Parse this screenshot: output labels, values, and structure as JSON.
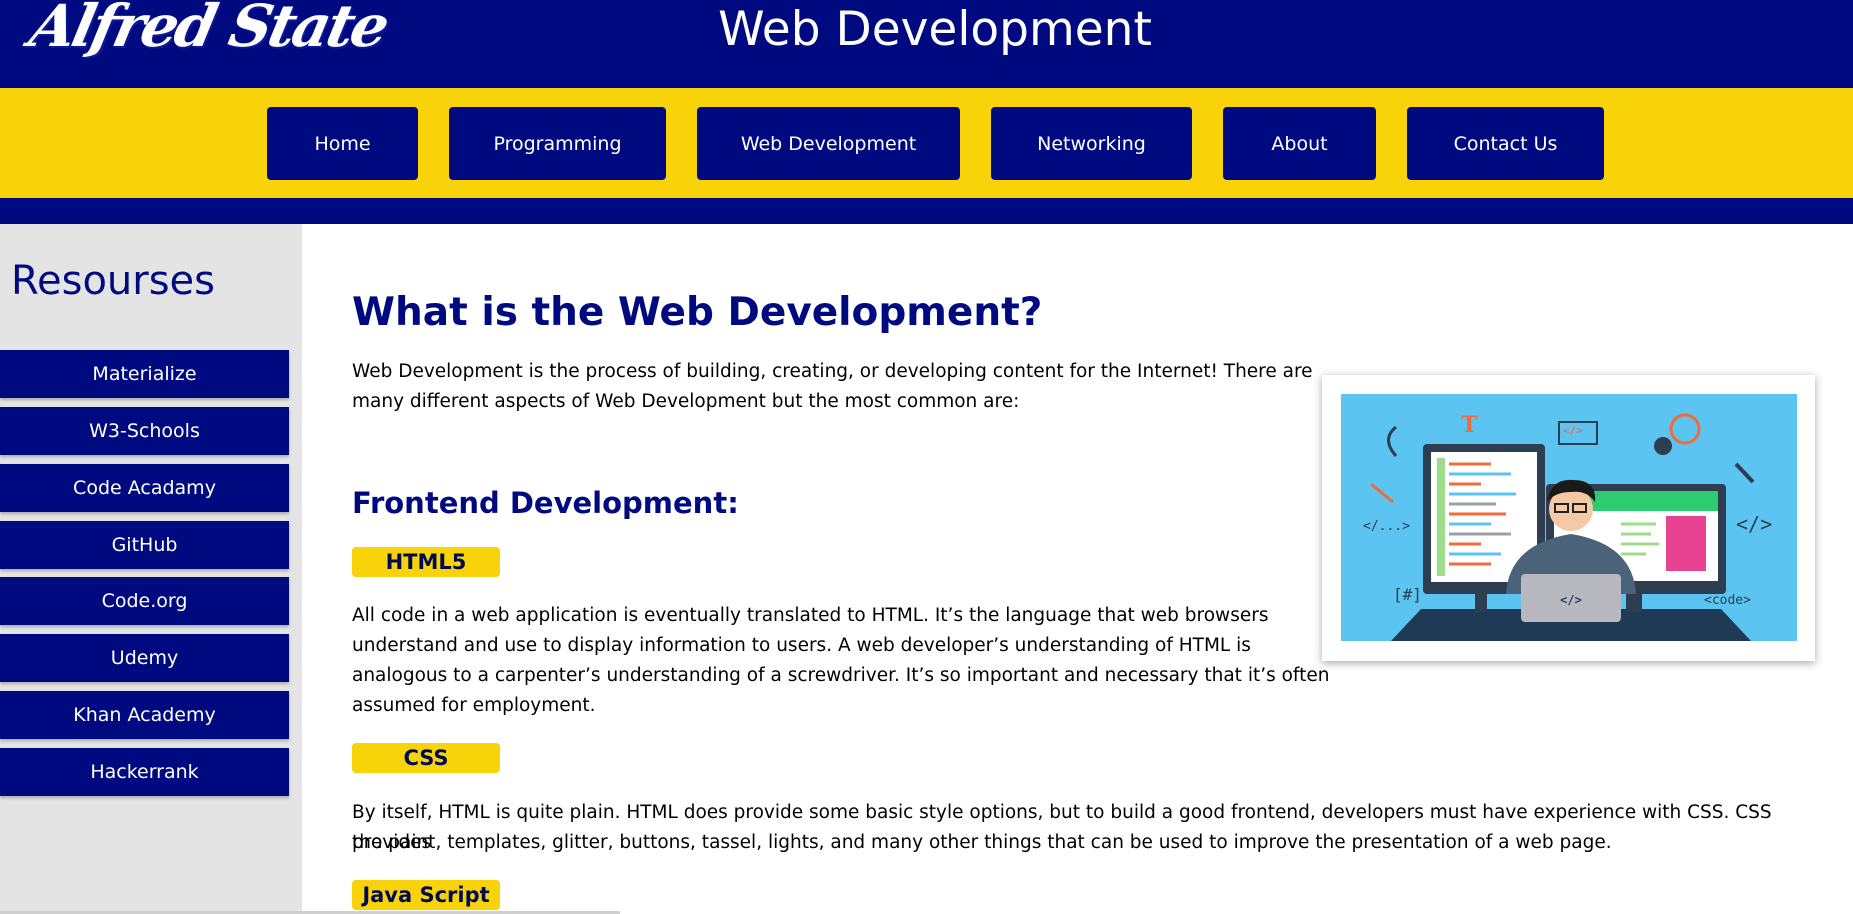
{
  "header": {
    "logo_text": "Alfred State",
    "title": "Web Development"
  },
  "nav": {
    "items": [
      "Home",
      "Programming",
      "Web Development",
      "Networking",
      "About",
      "Contact Us"
    ]
  },
  "sidebar": {
    "title": "Resourses",
    "items": [
      "Materialize",
      "W3-Schools",
      "Code Acadamy",
      "GitHub",
      "Code.org",
      "Udemy",
      "Khan Academy",
      "Hackerrank"
    ]
  },
  "main": {
    "heading": "What is the Web Development?",
    "intro_line1": "Web Development is the process of building, creating, or developing content for the Internet! There are",
    "intro_line2": "many different aspects of Web Development but the most common are:",
    "frontend_heading": "Frontend Development:",
    "html_tag": "HTML5",
    "html_line1": "All code in a web application is eventually translated to HTML. It’s the language that web browsers",
    "html_line2": "understand and use to display information to users. A web developer’s understanding of HTML is",
    "html_line3": "analogous to a carpenter’s understanding of a screwdriver. It’s so important and necessary that it’s often",
    "html_line4": "assumed for employment.",
    "css_tag": "CSS",
    "css_line1": "By itself, HTML is quite plain. HTML does provide some basic style options, but to build a good frontend, developers must have experience with CSS. CSS provides",
    "css_line2": "the paint, templates, glitter, buttons, tassel, lights, and many other things that can be used to improve the presentation of a web page.",
    "js_tag": "Java Script"
  },
  "illustration": {
    "code_labels": [
      "</...>",
      "[#]",
      "</>",
      "<code>",
      "</>"
    ],
    "colors": {
      "bg": "#5bc4f0",
      "desk": "#1e3a55",
      "accent": "#f26b3a"
    }
  },
  "colors": {
    "navy": "#000a80",
    "yellow": "#f8d30a",
    "sidebar_bg": "#e4e4e4"
  }
}
